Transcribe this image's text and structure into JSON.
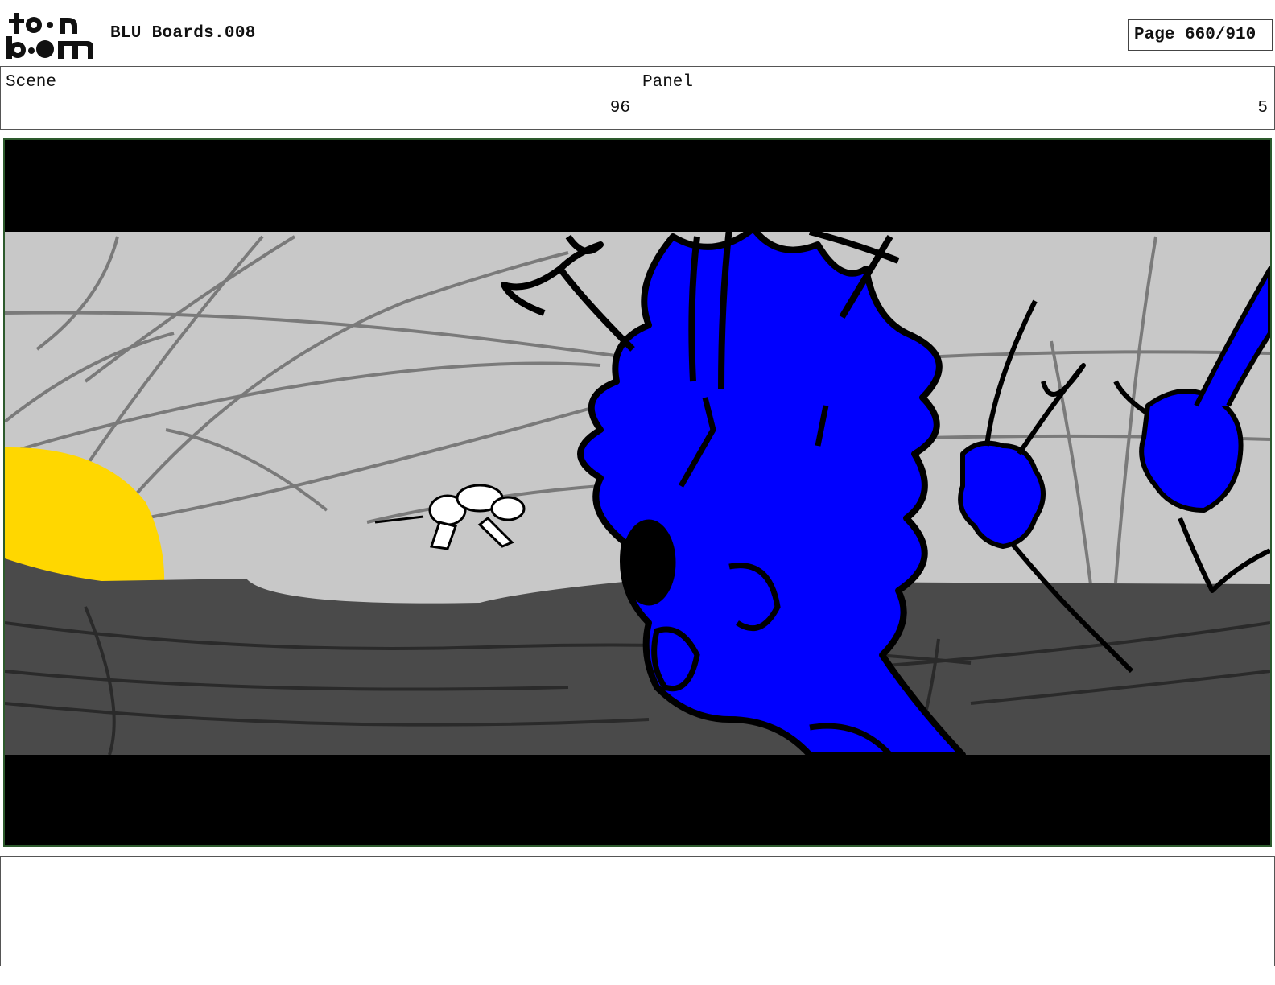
{
  "header": {
    "brand": "toon boom",
    "title": "BLU Boards.008",
    "page_label": "Page 660/910"
  },
  "scene": {
    "label": "Scene",
    "value": "96"
  },
  "panel": {
    "label": "Panel",
    "value": "5"
  },
  "colors": {
    "sky": "#c8c8c8",
    "ground": "#4a4a4a",
    "sun": "#ffd700",
    "creature_fill": "#0000ff",
    "letterbox": "#000000",
    "frame_border": "#2d5a2d"
  },
  "notes": {
    "text": ""
  }
}
